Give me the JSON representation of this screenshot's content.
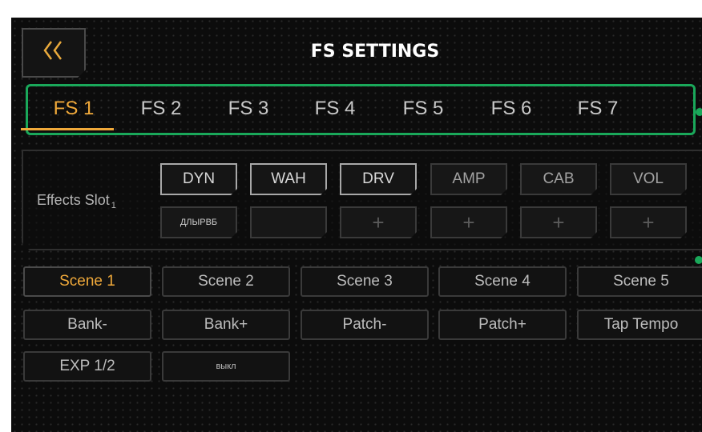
{
  "header": {
    "back_glyph": "《",
    "title": "FS SETTINGS"
  },
  "fs_tabs": [
    "FS 1",
    "FS 2",
    "FS 3",
    "FS 4",
    "FS 5",
    "FS 6",
    "FS 7"
  ],
  "effects": {
    "label": "Effects Slot",
    "label_sub": "1",
    "modules": [
      "DYN",
      "WAH",
      "DRV",
      "AMP",
      "CAB",
      "VOL"
    ],
    "slot_1_text": "ДЛЫРВБ",
    "slot_plus": "+"
  },
  "buttons": {
    "row1": [
      "Scene 1",
      "Scene 2",
      "Scene 3",
      "Scene 4",
      "Scene 5"
    ],
    "row2": [
      "Bank-",
      "Bank+",
      "Patch-",
      "Patch+",
      "Tap Tempo"
    ],
    "row3": [
      "EXP 1/2",
      "выкл"
    ]
  },
  "colors": {
    "accent": "#f0a93a",
    "highlight_border": "#1aa85a",
    "background": "#0c0c0c"
  }
}
